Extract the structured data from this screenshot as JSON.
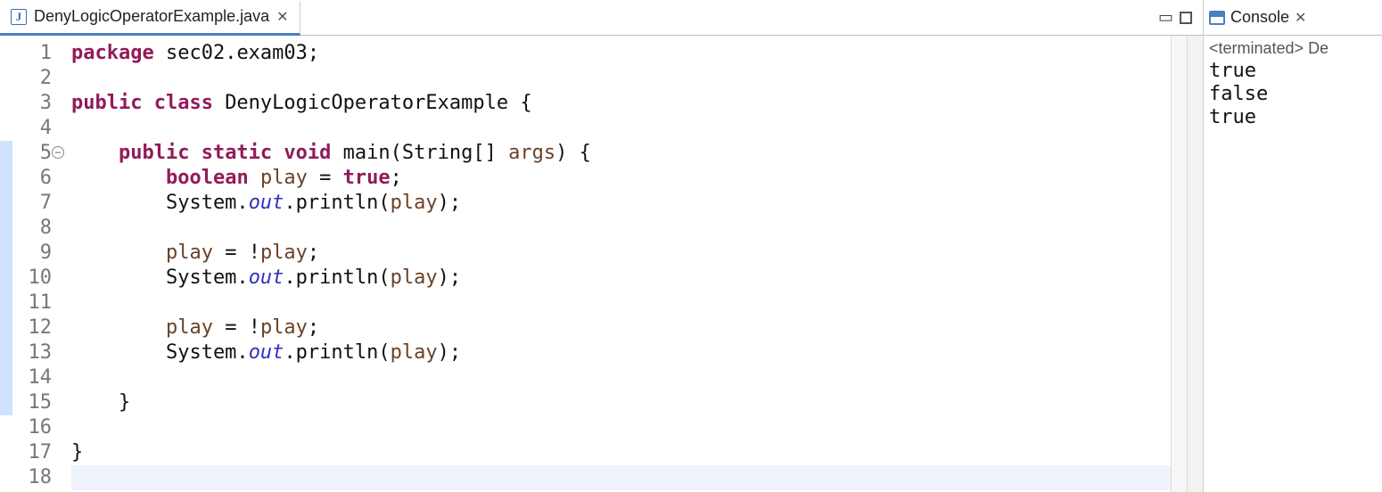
{
  "editor": {
    "tab": {
      "file_icon_letter": "J",
      "filename": "DenyLogicOperatorExample.java",
      "close_glyph": "✕"
    },
    "code": {
      "lines": [
        {
          "n": 1,
          "hl": false,
          "fold": false,
          "segs": [
            {
              "t": "package ",
              "c": "kw"
            },
            {
              "t": "sec02.exam03;",
              "c": "pkg"
            }
          ]
        },
        {
          "n": 2,
          "hl": false,
          "fold": false,
          "segs": [
            {
              "t": "",
              "c": ""
            }
          ]
        },
        {
          "n": 3,
          "hl": false,
          "fold": false,
          "segs": [
            {
              "t": "public class ",
              "c": "kw"
            },
            {
              "t": "DenyLogicOperatorExample {",
              "c": "pkg"
            }
          ]
        },
        {
          "n": 4,
          "hl": false,
          "fold": false,
          "segs": [
            {
              "t": "",
              "c": ""
            }
          ]
        },
        {
          "n": 5,
          "hl": true,
          "fold": true,
          "segs": [
            {
              "t": "    ",
              "c": ""
            },
            {
              "t": "public static void ",
              "c": "kw"
            },
            {
              "t": "main(String[] ",
              "c": "pkg"
            },
            {
              "t": "args",
              "c": "param"
            },
            {
              "t": ") {",
              "c": "pkg"
            }
          ]
        },
        {
          "n": 6,
          "hl": true,
          "fold": false,
          "segs": [
            {
              "t": "        ",
              "c": ""
            },
            {
              "t": "boolean ",
              "c": "kw"
            },
            {
              "t": "play",
              "c": "param"
            },
            {
              "t": " = ",
              "c": "pkg"
            },
            {
              "t": "true",
              "c": "kw"
            },
            {
              "t": ";",
              "c": "pkg"
            }
          ]
        },
        {
          "n": 7,
          "hl": true,
          "fold": false,
          "segs": [
            {
              "t": "        System.",
              "c": "pkg"
            },
            {
              "t": "out",
              "c": "fld"
            },
            {
              "t": ".println(",
              "c": "pkg"
            },
            {
              "t": "play",
              "c": "param"
            },
            {
              "t": ");",
              "c": "pkg"
            }
          ]
        },
        {
          "n": 8,
          "hl": true,
          "fold": false,
          "segs": [
            {
              "t": "",
              "c": ""
            }
          ]
        },
        {
          "n": 9,
          "hl": true,
          "fold": false,
          "segs": [
            {
              "t": "        ",
              "c": ""
            },
            {
              "t": "play",
              "c": "param"
            },
            {
              "t": " = !",
              "c": "pkg"
            },
            {
              "t": "play",
              "c": "param"
            },
            {
              "t": ";",
              "c": "pkg"
            }
          ]
        },
        {
          "n": 10,
          "hl": true,
          "fold": false,
          "segs": [
            {
              "t": "        System.",
              "c": "pkg"
            },
            {
              "t": "out",
              "c": "fld"
            },
            {
              "t": ".println(",
              "c": "pkg"
            },
            {
              "t": "play",
              "c": "param"
            },
            {
              "t": ");",
              "c": "pkg"
            }
          ]
        },
        {
          "n": 11,
          "hl": true,
          "fold": false,
          "segs": [
            {
              "t": "",
              "c": ""
            }
          ]
        },
        {
          "n": 12,
          "hl": true,
          "fold": false,
          "segs": [
            {
              "t": "        ",
              "c": ""
            },
            {
              "t": "play",
              "c": "param"
            },
            {
              "t": " = !",
              "c": "pkg"
            },
            {
              "t": "play",
              "c": "param"
            },
            {
              "t": ";",
              "c": "pkg"
            }
          ]
        },
        {
          "n": 13,
          "hl": true,
          "fold": false,
          "segs": [
            {
              "t": "        System.",
              "c": "pkg"
            },
            {
              "t": "out",
              "c": "fld"
            },
            {
              "t": ".println(",
              "c": "pkg"
            },
            {
              "t": "play",
              "c": "param"
            },
            {
              "t": ");",
              "c": "pkg"
            }
          ]
        },
        {
          "n": 14,
          "hl": true,
          "fold": false,
          "segs": [
            {
              "t": "",
              "c": ""
            }
          ]
        },
        {
          "n": 15,
          "hl": true,
          "fold": false,
          "segs": [
            {
              "t": "    }",
              "c": "pkg"
            }
          ]
        },
        {
          "n": 16,
          "hl": false,
          "fold": false,
          "segs": [
            {
              "t": "",
              "c": ""
            }
          ]
        },
        {
          "n": 17,
          "hl": false,
          "fold": false,
          "segs": [
            {
              "t": "}",
              "c": "pkg"
            }
          ]
        },
        {
          "n": 18,
          "hl": false,
          "fold": false,
          "cursor": true,
          "segs": [
            {
              "t": "",
              "c": ""
            }
          ]
        }
      ]
    }
  },
  "console": {
    "title": "Console",
    "close_glyph": "✕",
    "status": "<terminated> De",
    "output": [
      "true",
      "false",
      "true"
    ]
  },
  "toolbar": {
    "minimize_glyph": "▭",
    "maximize_glyph": "□"
  }
}
